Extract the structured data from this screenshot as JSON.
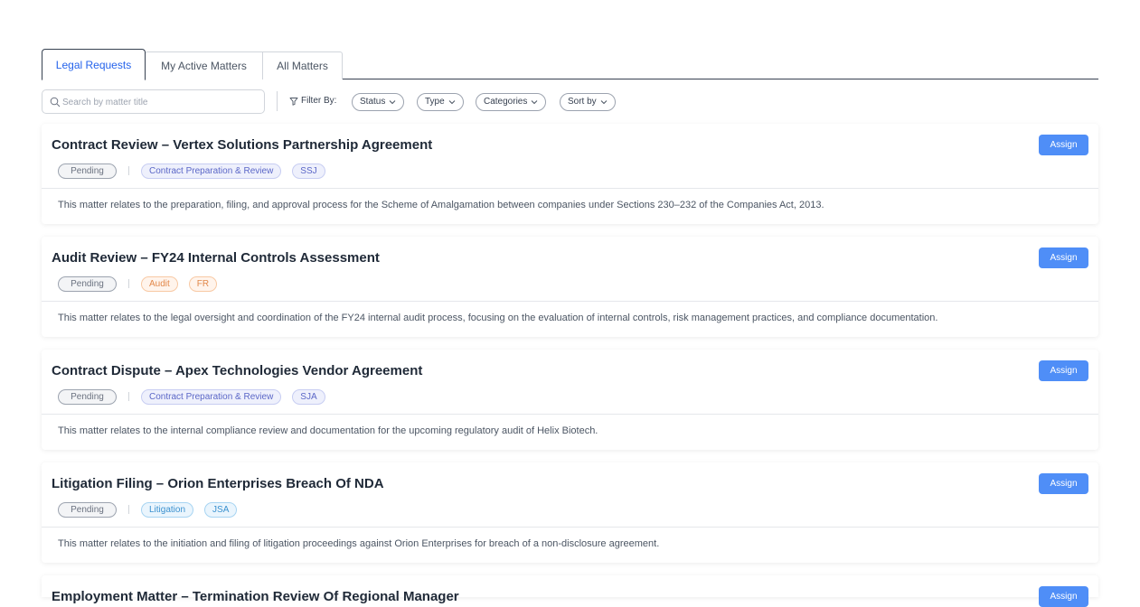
{
  "tabs": [
    {
      "label": "Legal Requests"
    },
    {
      "label": "My Active Matters"
    },
    {
      "label": "All Matters"
    }
  ],
  "search": {
    "placeholder": "Search by matter title"
  },
  "filters": {
    "label": "Filter By:",
    "chips": [
      "Status",
      "Type",
      "Categories",
      "Sort by"
    ]
  },
  "assign_label": "Assign",
  "matters": [
    {
      "title": "Contract Review – Vertex Solutions Partnership Agreement",
      "status": "Pending",
      "category": "Contract Preparation & Review",
      "initials": "SSJ",
      "description": "This matter relates to the preparation, filing, and approval process for the Scheme of Amalgamation between companies under Sections 230–232 of the Companies Act, 2013."
    },
    {
      "title": "Audit Review – FY24 Internal Controls Assessment",
      "status": "Pending",
      "category": "Audit",
      "initials": "FR",
      "description": "This matter relates to the legal oversight and coordination of the FY24 internal audit process, focusing on the evaluation of internal controls, risk management practices, and compliance documentation."
    },
    {
      "title": "Contract Dispute – Apex Technologies Vendor Agreement",
      "status": "Pending",
      "category": "Contract Preparation & Review",
      "initials": "SJA",
      "description": "This matter relates to the internal compliance review and documentation for the upcoming regulatory audit of Helix Biotech."
    },
    {
      "title": "Litigation Filing – Orion Enterprises Breach Of NDA",
      "status": "Pending",
      "category": "Litigation",
      "initials": "JSA",
      "description": "This matter relates to the initiation and filing of litigation proceedings against Orion Enterprises for breach of a non-disclosure agreement."
    },
    {
      "title": "Employment Matter – Termination Review Of Regional Manager",
      "status": "Pending",
      "category": "",
      "initials": "",
      "description": ""
    }
  ]
}
